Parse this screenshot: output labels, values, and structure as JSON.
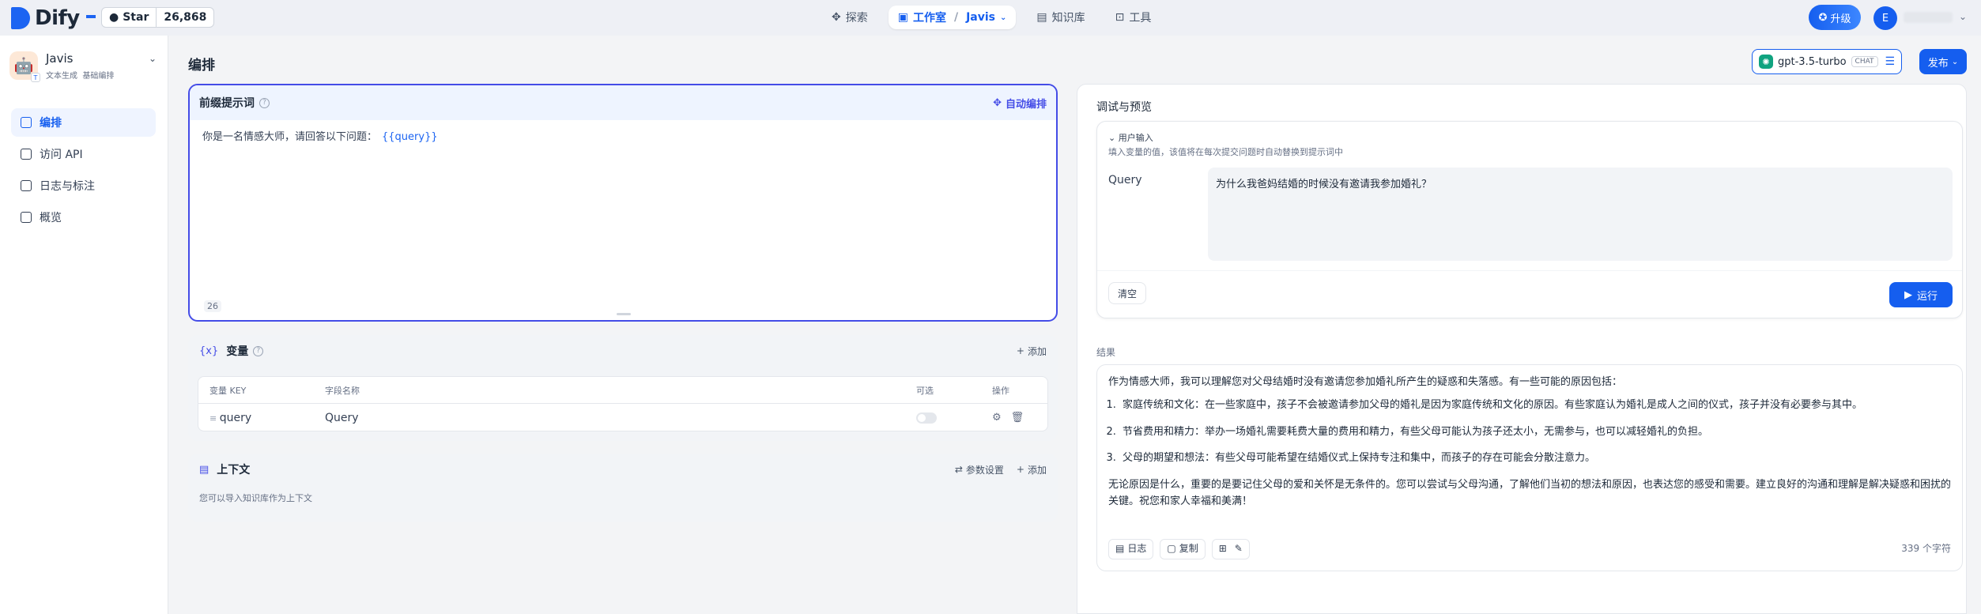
{
  "header": {
    "logo_text": "Dify",
    "github_star": "Star",
    "github_count": "26,868",
    "nav": [
      {
        "label": "探索",
        "icon": "compass-icon"
      },
      {
        "label": "工作室",
        "icon": "studio-icon",
        "sub": "Javis"
      },
      {
        "label": "知识库",
        "icon": "book-icon"
      },
      {
        "label": "工具",
        "icon": "tool-icon"
      }
    ],
    "upgrade_label": "升级",
    "avatar_initial": "E"
  },
  "sidebar": {
    "app_name": "Javis",
    "app_type": "文本生成",
    "app_mode": "基础编排",
    "items": [
      {
        "label": "编排"
      },
      {
        "label": "访问 API"
      },
      {
        "label": "日志与标注"
      },
      {
        "label": "概览"
      }
    ]
  },
  "main": {
    "title": "编排",
    "model_name": "gpt-3.5-turbo",
    "model_tag": "CHAT",
    "publish_label": "发布",
    "prompt": {
      "title": "前缀提示词",
      "auto_label": "自动编排",
      "text": "你是一名情感大师，请回答以下问题：",
      "var": "{{query}}",
      "count": "26"
    },
    "variables": {
      "title": "变量",
      "add_label": "添加",
      "headers": [
        "变量 KEY",
        "字段名称",
        "可选",
        "操作"
      ],
      "rows": [
        {
          "key": "query",
          "name": "Query"
        }
      ]
    },
    "context": {
      "title": "上下文",
      "params_label": "参数设置",
      "add_label": "添加",
      "note": "您可以导入知识库作为上下文"
    }
  },
  "preview": {
    "title": "调试与预览",
    "input_label": "用户输入",
    "input_hint": "填入变量的值，该值将在每次提交问题时自动替换到提示词中",
    "query_label": "Query",
    "query_value": "为什么我爸妈结婚的时候没有邀请我参加婚礼？",
    "clear_label": "清空",
    "run_label": "运行",
    "result_label": "结果",
    "result_intro": "作为情感大师，我可以理解您对父母结婚时没有邀请您参加婚礼所产生的疑惑和失落感。有一些可能的原因包括：",
    "result_items": [
      "家庭传统和文化：在一些家庭中，孩子不会被邀请参加父母的婚礼是因为家庭传统和文化的原因。有些家庭认为婚礼是成人之间的仪式，孩子并没有必要参与其中。",
      "节省费用和精力：举办一场婚礼需要耗费大量的费用和精力，有些父母可能认为孩子还太小，无需参与，也可以减轻婚礼的负担。",
      "父母的期望和想法：有些父母可能希望在结婚仪式上保持专注和集中，而孩子的存在可能会分散注意力。"
    ],
    "result_outro": "无论原因是什么，重要的是要记住父母的爱和关怀是无条件的。您可以尝试与父母沟通，了解他们当初的想法和原因，也表达您的感受和需要。建立良好的沟通和理解是解决疑惑和困扰的关键。祝您和家人幸福和美满！",
    "log_label": "日志",
    "copy_label": "复制",
    "char_count": "339 个字符"
  }
}
